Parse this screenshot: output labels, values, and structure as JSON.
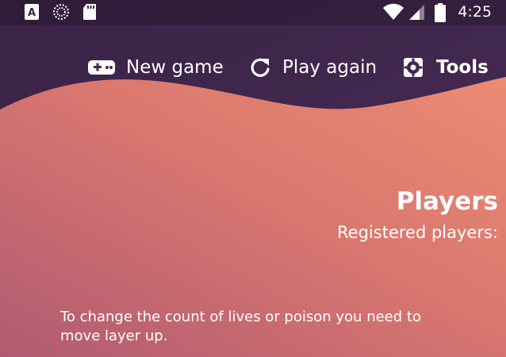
{
  "status_bar": {
    "time": "4:25",
    "icons": [
      "font-a-icon",
      "spinner-icon",
      "sd-card-icon",
      "wifi-icon",
      "signal-icon",
      "battery-icon"
    ],
    "notification_letter": "A"
  },
  "toolbar": {
    "new_game_label": "New game",
    "play_again_label": "Play again",
    "tools_label": "Tools",
    "new_game_icon": "gamepad-icon",
    "play_again_icon": "refresh-icon",
    "tools_icon": "gear-icon"
  },
  "players": {
    "title": "Players",
    "subtitle": "Registered players:"
  },
  "hint": {
    "text": "To change the count of lives or poison you need to move layer up."
  },
  "colors": {
    "top_background": "#3a2346",
    "gradient_start": "#b96173",
    "gradient_end": "#e88a73",
    "text": "#ffffff"
  }
}
